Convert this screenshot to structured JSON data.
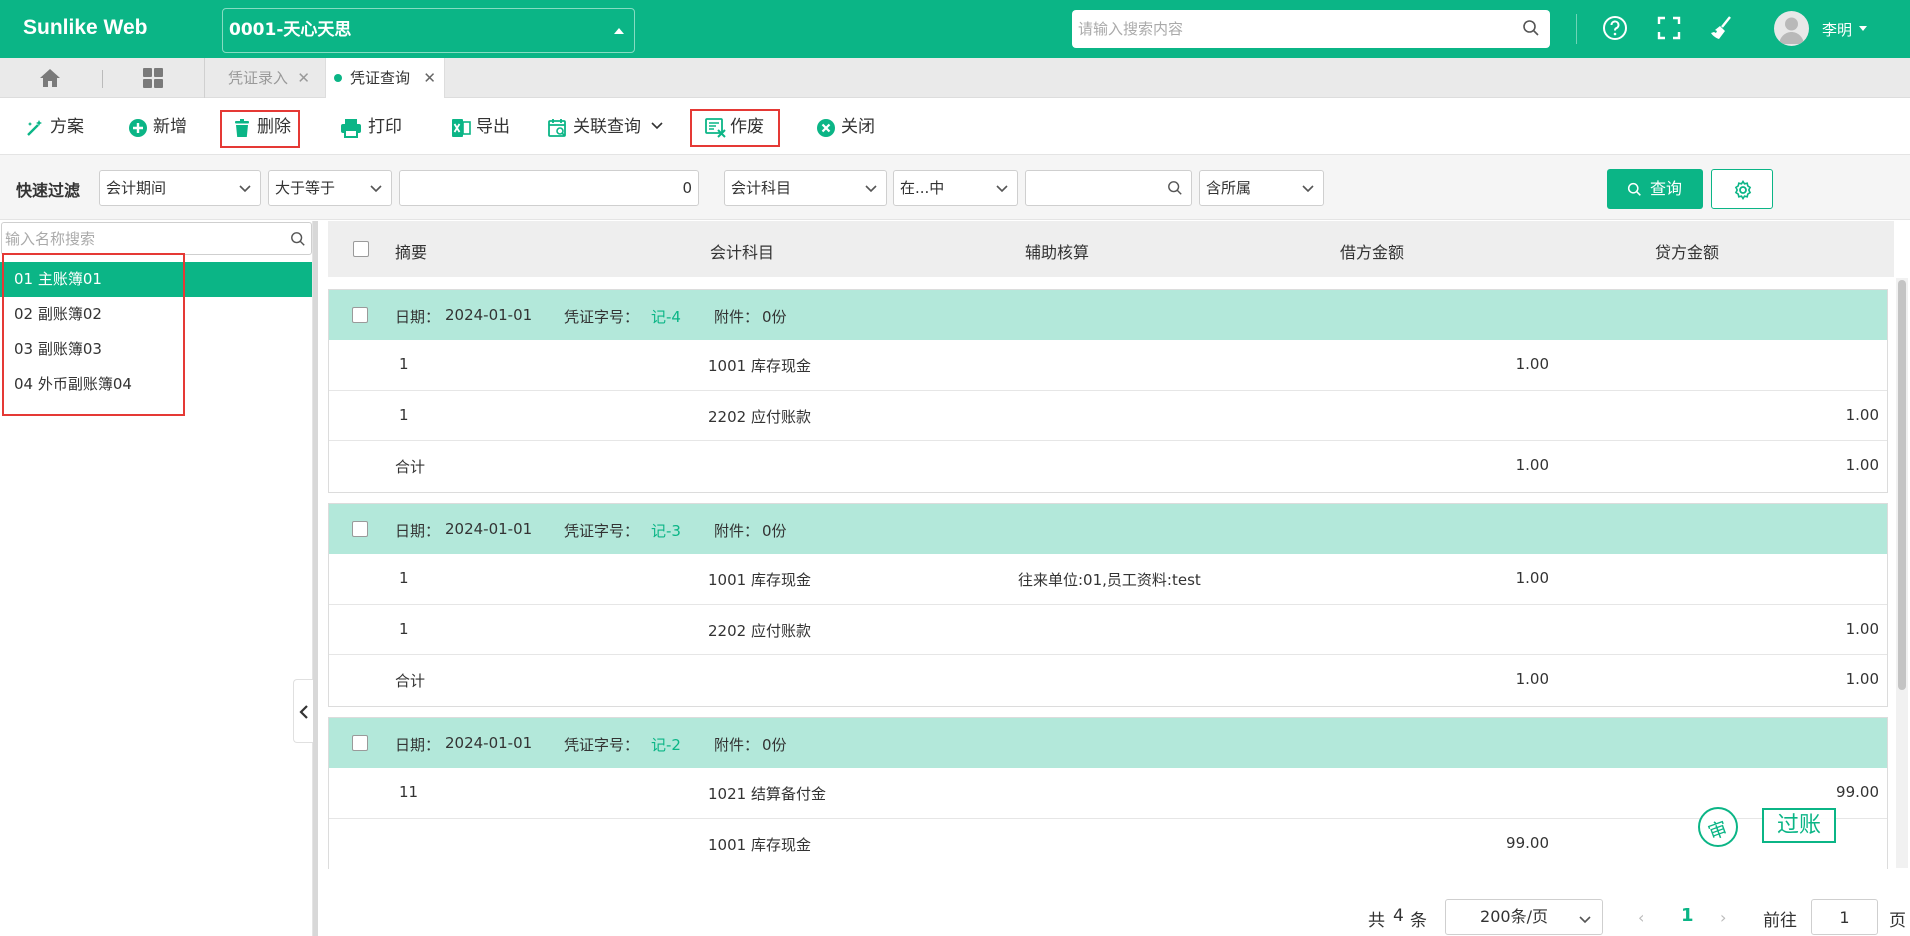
{
  "app": {
    "brand": "Sunlike Web",
    "account_selector": "0001-天心天思",
    "search_placeholder": "请输入搜索内容",
    "user_name": "李明",
    "accent_color": "#0bb586"
  },
  "tabs": [
    {
      "label": "凭证录入",
      "active": false
    },
    {
      "label": "凭证查询",
      "active": true
    }
  ],
  "toolbar": {
    "plan": "方案",
    "add": "新增",
    "delete": "删除",
    "print": "打印",
    "export": "导出",
    "related_query": "关联查询",
    "void": "作废",
    "close": "关闭"
  },
  "filter": {
    "label": "快速过滤",
    "field1": "会计期间",
    "op1": "大于等于",
    "value1": "0",
    "field2": "会计科目",
    "op2": "在...中",
    "value2": "",
    "scope": "含所属",
    "query_button": "查询"
  },
  "ledger_tree": {
    "search_placeholder": "输入名称搜索",
    "items": [
      {
        "label": "01 主账簿01",
        "selected": true
      },
      {
        "label": "02 副账簿02",
        "selected": false
      },
      {
        "label": "03 副账簿03",
        "selected": false
      },
      {
        "label": "04 外币副账簿04",
        "selected": false
      }
    ]
  },
  "grid": {
    "columns": [
      "摘要",
      "会计科目",
      "辅助核算",
      "借方金额",
      "贷方金额"
    ],
    "date_label": "日期：",
    "voucher_label": "凭证字号：",
    "attach_label": "附件：",
    "vouchers": [
      {
        "date": "2024-01-01",
        "number": "记-4",
        "attachments": "0份",
        "rows": [
          {
            "summary": "1",
            "account": "1001 库存现金",
            "aux": "",
            "debit": "1.00",
            "credit": ""
          },
          {
            "summary": "1",
            "account": "2202 应付账款",
            "aux": "",
            "debit": "",
            "credit": "1.00"
          },
          {
            "summary": "合计",
            "account": "",
            "aux": "",
            "debit": "1.00",
            "credit": "1.00"
          }
        ]
      },
      {
        "date": "2024-01-01",
        "number": "记-3",
        "attachments": "0份",
        "rows": [
          {
            "summary": "1",
            "account": "1001 库存现金",
            "aux": "往来单位:01,员工资料:test",
            "debit": "1.00",
            "credit": ""
          },
          {
            "summary": "1",
            "account": "2202 应付账款",
            "aux": "",
            "debit": "",
            "credit": "1.00"
          },
          {
            "summary": "合计",
            "account": "",
            "aux": "",
            "debit": "1.00",
            "credit": "1.00"
          }
        ]
      },
      {
        "date": "2024-01-01",
        "number": "记-2",
        "attachments": "0份",
        "rows": [
          {
            "summary": "11",
            "account": "1021 结算备付金",
            "aux": "",
            "debit": "",
            "credit": "99.00"
          },
          {
            "summary": "",
            "account": "1001 库存现金",
            "aux": "",
            "debit": "99.00",
            "credit": ""
          }
        ]
      }
    ]
  },
  "stamps": {
    "circle": "审",
    "posted": "过账"
  },
  "pager": {
    "total_prefix": "共",
    "total": "4",
    "total_suffix": "条",
    "page_size": "200条/页",
    "current_page": "1",
    "goto_label": "前往",
    "goto_value": "1",
    "page_suffix": "页"
  }
}
